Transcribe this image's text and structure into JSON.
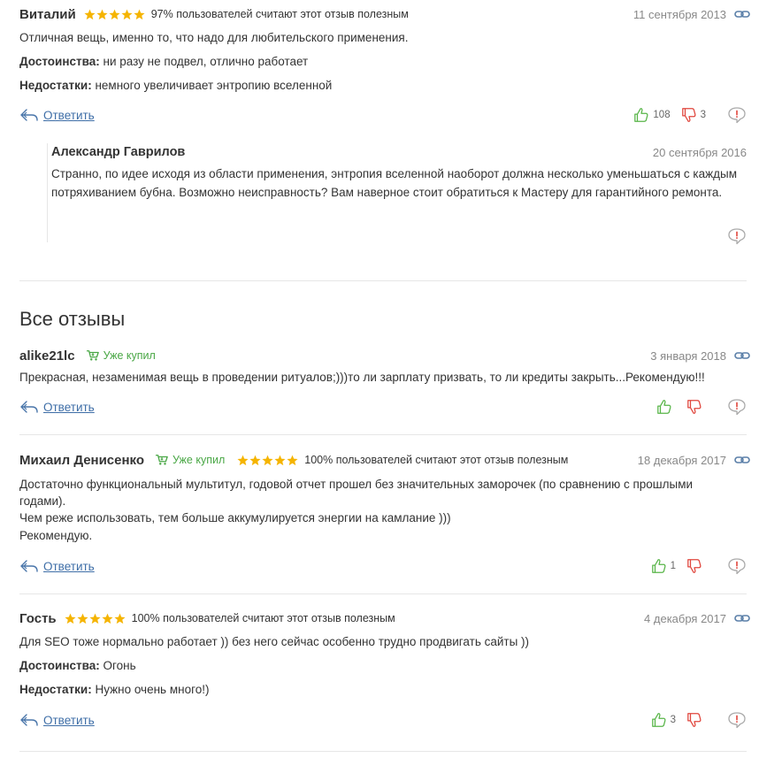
{
  "reviews": [
    {
      "author": "Виталий",
      "stars": 5,
      "useful": "97% пользователей считают этот отзыв полезным",
      "date": "11 сентября 2013",
      "text": "Отличная вещь, именно то, что надо для любительского применения.",
      "pros_label": "Достоинства:",
      "pros": "ни разу не подвел, отлично работает",
      "cons_label": "Недостатки:",
      "cons": "немного увеличивает энтропию вселенной",
      "reply": "Ответить",
      "likes": "108",
      "dislikes": "3",
      "comment": {
        "author": "Александр Гаврилов",
        "date": "20 сентября 2016",
        "text": "Странно, по идее исходя из области применения, энтропия вселенной наоборот должна несколько уменьшаться с каждым потряхиванием бубна. Возможно неисправность? Вам наверное стоит обратиться к Мастеру для гарантийного ремонта."
      }
    }
  ],
  "all_reviews_title": "Все отзывы",
  "all_reviews": [
    {
      "author": "alike21lc",
      "bought": "Уже купил",
      "date": "3 января 2018",
      "text": "Прекрасная, незаменимая вещь в проведении ритуалов;)))то ли зарплату призвать, то ли кредиты закрыть...Рекомендую!!!",
      "reply": "Ответить",
      "likes": "",
      "dislikes": ""
    },
    {
      "author": "Михаил Денисенко",
      "bought": "Уже купил",
      "stars": 5,
      "useful": "100% пользователей считают этот отзыв полезным",
      "date": "18 декабря 2017",
      "text1": "Достаточно функциональный мультитул, годовой отчет прошел без значительных заморочек (по сравнению с прошлыми годами).",
      "text2": "Чем реже использовать, тем больше аккумулируется энергии на камлание )))",
      "text3": "Рекомендую.",
      "reply": "Ответить",
      "likes": "1",
      "dislikes": ""
    },
    {
      "author": "Гость",
      "stars": 5,
      "useful": "100% пользователей считают этот отзыв полезным",
      "date": "4 декабря 2017",
      "text": "Для SEO тоже нормально работает )) без него сейчас особенно трудно продвигать сайты ))",
      "pros_label": "Достоинства:",
      "pros": "Огонь",
      "cons_label": "Недостатки:",
      "cons": "Нужно очень много!)",
      "reply": "Ответить",
      "likes": "3",
      "dislikes": ""
    }
  ],
  "colors": {
    "star": "#f5b400",
    "like": "#58b548",
    "dislike": "#e0453c",
    "link": "#3e6ea7",
    "bought": "#49a745"
  },
  "icons": [
    "star-icon",
    "link-icon",
    "reply-arrow-icon",
    "thumbs-up-icon",
    "thumbs-down-icon",
    "complain-icon",
    "cart-icon"
  ]
}
